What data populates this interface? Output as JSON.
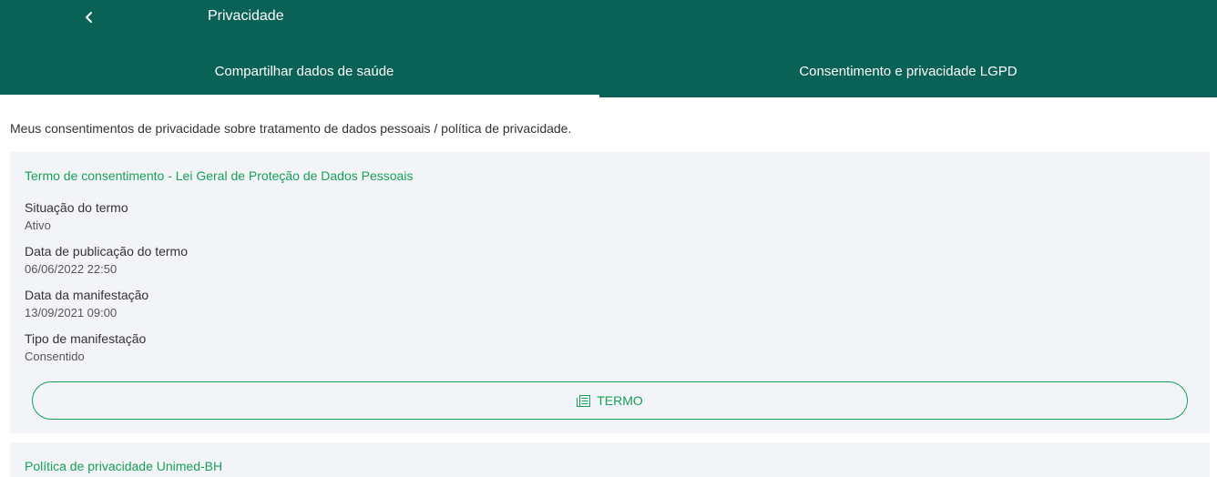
{
  "appbar": {
    "title": "Privacidade",
    "back_icon": "chevron-left-icon"
  },
  "tabs": [
    {
      "label": "Compartilhar dados de saúde",
      "active": true
    },
    {
      "label": "Consentimento e privacidade LGPD",
      "active": false
    }
  ],
  "intro": "Meus consentimentos de privacidade sobre tratamento de dados pessoais / política de privacidade.",
  "terms_card": {
    "title": "Termo de consentimento - Lei Geral de Proteção de Dados Pessoais",
    "fields": [
      {
        "label": "Situação do termo",
        "value": "Ativo"
      },
      {
        "label": "Data de publicação do termo",
        "value": "06/06/2022 22:50"
      },
      {
        "label": "Data da manifestação",
        "value": "13/09/2021 09:00"
      },
      {
        "label": "Tipo de manifestação",
        "value": "Consentido"
      }
    ],
    "button_label": "TERMO",
    "button_icon": "document-icon"
  },
  "privacy_card": {
    "title": "Política de privacidade Unimed-BH"
  },
  "colors": {
    "appbar": "#0a6155",
    "accent": "#16a05a",
    "card_bg": "#f3f4f7"
  }
}
